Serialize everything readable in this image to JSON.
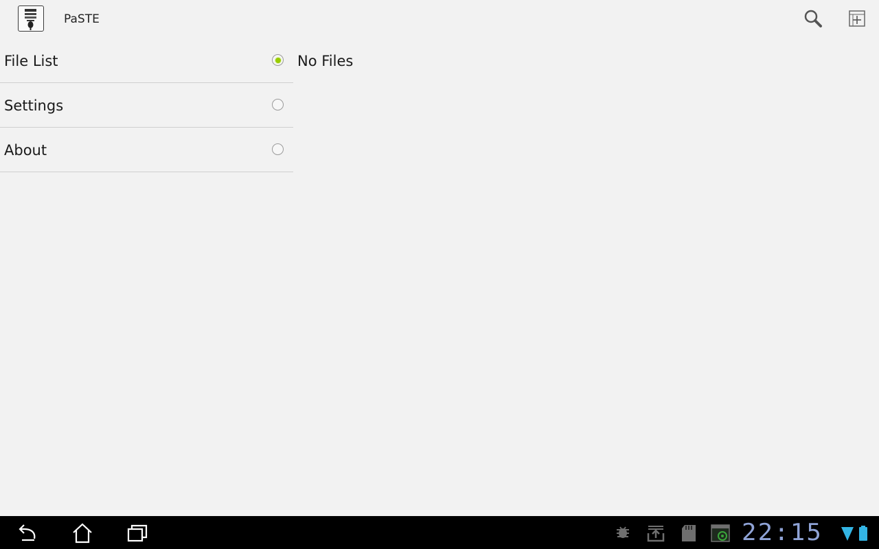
{
  "app": {
    "title": "PaSTE"
  },
  "actions": {
    "search_icon": "search-icon",
    "add_icon": "add-file-icon"
  },
  "nav": {
    "items": [
      {
        "label": "File List",
        "selected": true
      },
      {
        "label": "Settings",
        "selected": false
      },
      {
        "label": "About",
        "selected": false
      }
    ]
  },
  "content": {
    "empty_text": "No Files"
  },
  "system_bar": {
    "clock": "22:15",
    "buttons": [
      "back-icon",
      "home-icon",
      "recents-icon"
    ],
    "notifications": [
      "debug-icon",
      "download-icon",
      "sdcard-icon",
      "screenshot-icon"
    ]
  },
  "colors": {
    "accent": "#99cc00",
    "background": "#f2f2f2",
    "system_bar": "#000000",
    "clock": "#8fa3d6"
  }
}
